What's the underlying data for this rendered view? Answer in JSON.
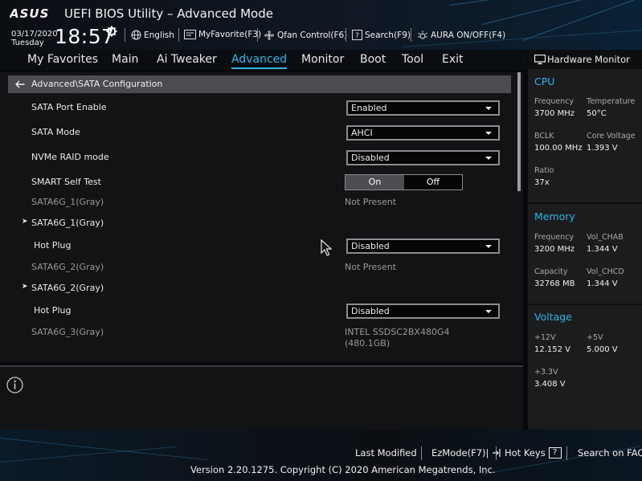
{
  "header": {
    "brand": "ASUS",
    "title": "UEFI BIOS Utility – Advanced Mode",
    "date": "03/17/2020",
    "weekday": "Tuesday",
    "time": "18:57",
    "tools": [
      {
        "label": "English",
        "icon": "globe-icon"
      },
      {
        "label": "MyFavorite(F3)",
        "icon": "favorite-icon"
      },
      {
        "label": "Qfan Control(F6)",
        "icon": "fan-icon"
      },
      {
        "label": "Search(F9)",
        "icon": "search-help-icon"
      },
      {
        "label": "AURA ON/OFF(F4)",
        "icon": "aura-icon"
      }
    ]
  },
  "menu": {
    "tabs": [
      "My Favorites",
      "Main",
      "Ai Tweaker",
      "Advanced",
      "Monitor",
      "Boot",
      "Tool",
      "Exit"
    ],
    "active": "Advanced"
  },
  "main": {
    "breadcrumb": "Advanced\\SATA Configuration",
    "rows": [
      {
        "label": "SATA Port Enable",
        "value": "Enabled"
      },
      {
        "label": "SATA Mode",
        "value": "AHCI"
      },
      {
        "label": "NVMe RAID mode",
        "value": "Disabled"
      },
      {
        "label": "SMART Self Test",
        "on": "On",
        "off": "Off"
      },
      {
        "label": "SATA6G_1(Gray)",
        "value": "Not Present"
      },
      {
        "label": "SATA6G_1(Gray)"
      },
      {
        "label": "Hot Plug",
        "value": "Disabled"
      },
      {
        "label": "SATA6G_2(Gray)",
        "value": "Not Present"
      },
      {
        "label": "SATA6G_2(Gray)"
      },
      {
        "label": "Hot Plug",
        "value": "Disabled"
      },
      {
        "label": "SATA6G_3(Gray)",
        "value": "INTEL SSDSC2BX480G4",
        "value2": "(480.1GB)"
      }
    ]
  },
  "hw_monitor": {
    "title": "Hardware Monitor",
    "cpu": {
      "heading": "CPU",
      "frequency_label": "Frequency",
      "frequency": "3700 MHz",
      "temperature_label": "Temperature",
      "temperature": "50°C",
      "bclk_label": "BCLK",
      "bclk": "100.00 MHz",
      "core_voltage_label": "Core Voltage",
      "core_voltage": "1.393 V",
      "ratio_label": "Ratio",
      "ratio": "37x"
    },
    "memory": {
      "heading": "Memory",
      "frequency_label": "Frequency",
      "frequency": "3200 MHz",
      "vol_chab_label": "Vol_CHAB",
      "vol_chab": "1.344 V",
      "capacity_label": "Capacity",
      "capacity": "32768 MB",
      "vol_chcd_label": "Vol_CHCD",
      "vol_chcd": "1.344 V"
    },
    "voltage": {
      "heading": "Voltage",
      "v12_label": "+12V",
      "v12": "12.152 V",
      "v5_label": "+5V",
      "v5": "5.000 V",
      "v33_label": "+3.3V",
      "v33": "3.408 V"
    }
  },
  "footer": {
    "last_modified": "Last Modified",
    "ezmode": "EzMode(F7)|",
    "hot_keys": "Hot Keys",
    "hot_keys_key": "?",
    "search_faq": "Search on FAQ",
    "copyright": "Version 2.20.1275. Copyright (C) 2020 American Megatrends, Inc."
  },
  "colors": {
    "accent": "#2fb6e6",
    "panel": "#111315",
    "breadcrumb_bar": "#4a4c4f"
  }
}
